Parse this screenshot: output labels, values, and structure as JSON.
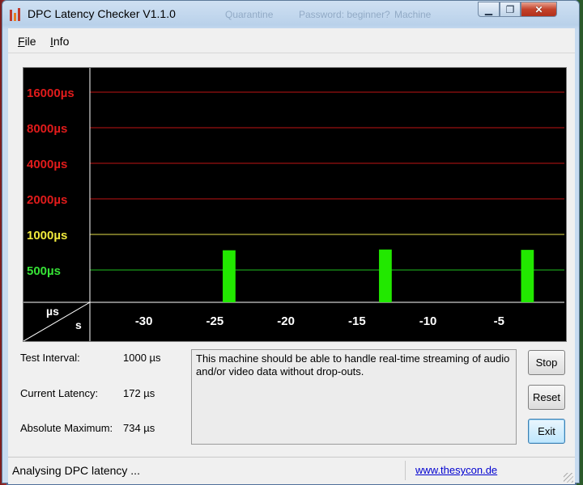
{
  "window": {
    "title": "DPC Latency Checker V1.1.0",
    "background_titles": [
      "Quarantine",
      "Password: beginner?",
      "Machine"
    ],
    "controls": {
      "minimize_glyph": "▁",
      "maximize_glyph": "❐",
      "close_glyph": "✕"
    }
  },
  "menu": {
    "file": {
      "accel": "F",
      "rest": "ile"
    },
    "info": {
      "accel": "I",
      "rest": "nfo"
    }
  },
  "colors": {
    "bar": "#22e800",
    "gridline_red": "#c01414",
    "gridline_yellow": "#e6e04a",
    "gridline_green": "#20c020",
    "label_red": "#e01b1b",
    "label_yellow": "#f0ea3c",
    "label_green": "#36e236",
    "axis_text": "#ffffff"
  },
  "chart_data": {
    "type": "bar",
    "y_scale": "log",
    "y_unit_label": "µs",
    "x_unit_label": "s",
    "x_ticks": [
      "-30",
      "-25",
      "-20",
      "-15",
      "-10",
      "-5"
    ],
    "y_gridlines": [
      {
        "value": 16000,
        "label": "16000µs",
        "tone": "red"
      },
      {
        "value": 8000,
        "label": "8000µs",
        "tone": "red"
      },
      {
        "value": 4000,
        "label": "4000µs",
        "tone": "red"
      },
      {
        "value": 2000,
        "label": "2000µs",
        "tone": "red"
      },
      {
        "value": 1000,
        "label": "1000µs",
        "tone": "yellow"
      },
      {
        "value": 500,
        "label": "500µs",
        "tone": "green"
      }
    ],
    "x": [
      -33,
      -32,
      -31,
      -30,
      -29,
      -28,
      -27,
      -26,
      -25,
      -24,
      -23,
      -22,
      -21,
      -20,
      -19,
      -18,
      -17,
      -16,
      -15,
      -14,
      -13,
      -12,
      -11,
      -10,
      -9,
      -8,
      -7,
      -6,
      -5,
      -4,
      -3,
      -2,
      -1
    ],
    "values": [
      180,
      190,
      210,
      190,
      200,
      195,
      190,
      185,
      205,
      734,
      185,
      190,
      195,
      165,
      190,
      170,
      165,
      170,
      180,
      175,
      745,
      175,
      170,
      180,
      190,
      170,
      175,
      175,
      170,
      170,
      740,
      175,
      172
    ]
  },
  "info": {
    "test_interval": {
      "label": "Test Interval:",
      "value": "1000 µs"
    },
    "current_latency": {
      "label": "Current Latency:",
      "value": "172 µs"
    },
    "absolute_maximum": {
      "label": "Absolute Maximum:",
      "value": "734 µs"
    }
  },
  "message": "This machine should be able to handle real-time streaming of audio and/or video data without drop-outs.",
  "buttons": {
    "stop": "Stop",
    "reset": "Reset",
    "exit": "Exit"
  },
  "status": {
    "text": "Analysing DPC latency ...",
    "link": "www.thesycon.de"
  }
}
